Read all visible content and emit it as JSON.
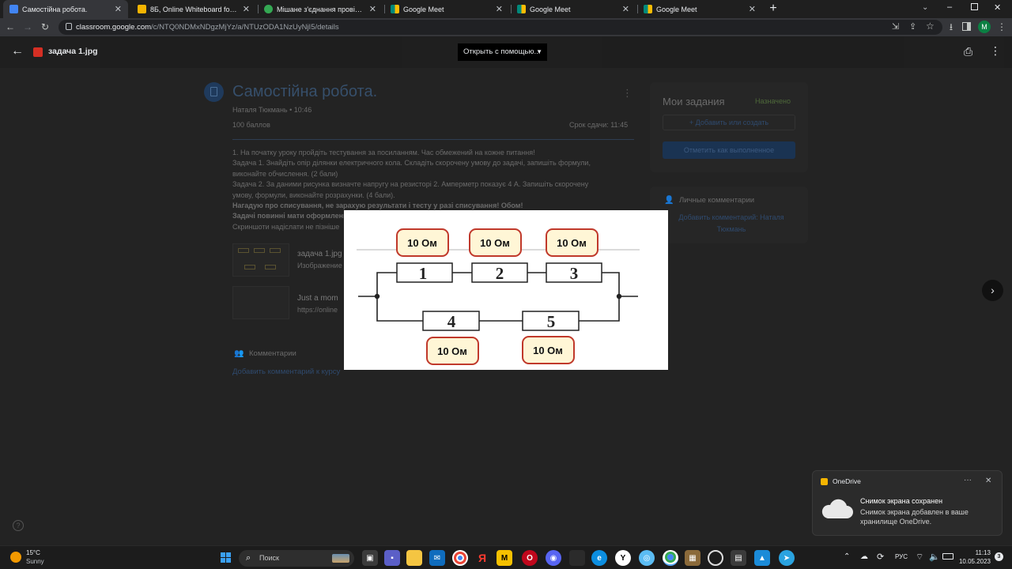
{
  "tabs": [
    {
      "title": "Самостійна робота.",
      "active": true,
      "color": "#4285f4"
    },
    {
      "title": "8Б, Online Whiteboard for Visual",
      "active": false,
      "color": "#f4b400"
    },
    {
      "title": "Мішане з'єднання провідників",
      "active": false,
      "color": "#34a853"
    },
    {
      "title": "Google Meet",
      "active": false,
      "color": "#00897b"
    },
    {
      "title": "Google Meet",
      "active": false,
      "color": "#00897b"
    },
    {
      "title": "Google Meet",
      "active": false,
      "color": "#00897b"
    }
  ],
  "address": {
    "host": "classroom.google.com",
    "path": "/c/NTQ0NDMxNDgzMjYz/a/NTUzODA1NzUyNjI5/details"
  },
  "profile_initial": "M",
  "viewer": {
    "filename": "задача 1.jpg",
    "open_with": "Открыть с помощью..."
  },
  "assignment": {
    "title": "Самостійна робота.",
    "meta": "Наталя Тюкмань • 10:46",
    "points": "100 баллов",
    "due": "Срок сдачи: 11:45",
    "lines": [
      "1. На початку уроку пройдіть тестування за посиланням. Час обмежений на кожне питання!",
      "Задача 1. Знайдіть опір ділянки електричного кола. Складіть скорочену умову до задачі, запишіть формули,",
      "виконайте обчислення. (2 бали)",
      "Задача 2. За даними рисунка визначте напругу на резисторі 2. Амперметр показує 4 А. Запишіть скорочену",
      "умову, формули, виконайте розрахунки. (4 бали)."
    ],
    "bold_lines": [
      "Нагадую про списування, не зарахую результати і тесту у разі списування! Обом!",
      "Задачі повинні мати оформлення"
    ],
    "last_line": "Скриншоти надіслати не пізніше",
    "attachments": [
      {
        "name": "задача 1.jpg",
        "type": "Изображение"
      },
      {
        "name": "Just a mom",
        "type": "https://online"
      }
    ],
    "comments_label": "Комментарии",
    "add_comment": "Добавить комментарий к курсу"
  },
  "my_tasks": {
    "title": "Мои задания",
    "status": "Назначено",
    "add_button": "+ Добавить или создать",
    "done_button": "Отметить как выполненное",
    "private_title": "Личные комментарии",
    "private_add": "Добавить комментарий: Наталя Тюкмань"
  },
  "circuit": {
    "resistors_top": [
      "1",
      "2",
      "3"
    ],
    "resistors_bottom": [
      "4",
      "5"
    ],
    "labels_top": [
      "10 Ом",
      "10 Ом",
      "10 Ом"
    ],
    "labels_bottom": [
      "10 Ом",
      "10 Ом"
    ]
  },
  "toast": {
    "app": "OneDrive",
    "title": "Снимок экрана сохранен",
    "body": "Снимок экрана добавлен в ваше хранилище OneDrive."
  },
  "taskbar": {
    "temp": "15°C",
    "weather": "Sunny",
    "search": "Поиск",
    "lang": "РУС",
    "time": "11:13",
    "date": "10.05.2023",
    "badge": "3"
  }
}
